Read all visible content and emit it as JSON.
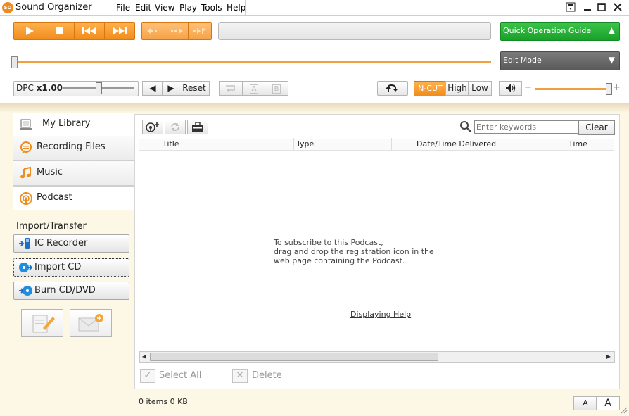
{
  "app": {
    "title": "Sound Organizer",
    "logo_text": "SO"
  },
  "menu": [
    {
      "label": "File",
      "key": "F"
    },
    {
      "label": "Edit",
      "key": "E"
    },
    {
      "label": "View",
      "key": "V"
    },
    {
      "label": "Play",
      "key": "P"
    },
    {
      "label": "Tools",
      "key": "T"
    },
    {
      "label": "Help",
      "key": "H"
    }
  ],
  "playback": {
    "seek_progress": 0.0,
    "quick_guide_label": "Quick Operation Guide",
    "edit_mode_label": "Edit Mode"
  },
  "dpc": {
    "label": "DPC",
    "value": "x1.00",
    "slider_level": 0.5,
    "reset_label": "Reset"
  },
  "ab": {
    "a": "A",
    "b": "B"
  },
  "noise_cut": {
    "label": "N-CUT",
    "high": "High",
    "low": "Low"
  },
  "volume": {
    "level": 1.0,
    "minus": "−",
    "plus": "+"
  },
  "nav": {
    "tabs": [
      {
        "label": "My Library",
        "icon": "library-icon"
      },
      {
        "label": "Recording Files",
        "icon": "recording-files-icon"
      },
      {
        "label": "Music",
        "icon": "music-note-icon"
      },
      {
        "label": "Podcast",
        "icon": "podcast-icon"
      }
    ],
    "import_header": "Import/Transfer",
    "buttons": [
      {
        "label": "IC Recorder",
        "icon": "ic-recorder-icon"
      },
      {
        "label": "Import CD",
        "icon": "import-cd-icon"
      },
      {
        "label": "Burn CD/DVD",
        "icon": "burn-cd-icon"
      }
    ]
  },
  "content": {
    "search_placeholder": "Enter keywords",
    "clear_label": "Clear",
    "columns": [
      "Title",
      "Type",
      "Date/Time Delivered",
      "Time"
    ],
    "empty_message": [
      "To subscribe to this Podcast,",
      "drag and drop the registration icon in the",
      "web page containing the Podcast."
    ],
    "help_link": "Displaying Help",
    "select_all": "Select All",
    "delete": "Delete"
  },
  "status": {
    "text": "0 items 0 KB",
    "font_small": "A",
    "font_large": "A"
  },
  "colors": {
    "accent": "#f08c1b",
    "guide_green": "#1aa02a",
    "edit_gray": "#5a5a5a"
  }
}
